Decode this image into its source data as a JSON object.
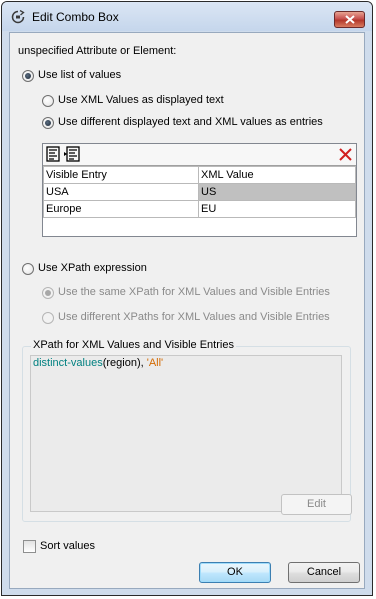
{
  "window": {
    "title": "Edit Combo Box"
  },
  "dialog": {
    "heading": "unspecified Attribute or Element:",
    "use_list_label": "Use list of values",
    "use_xml_values_label": "Use XML Values as displayed text",
    "use_different_label": "Use different displayed text and XML values as entries",
    "table": {
      "headers": [
        "Visible Entry",
        "XML Value"
      ],
      "rows": [
        [
          "USA",
          "US"
        ],
        [
          "Europe",
          "EU"
        ]
      ]
    },
    "use_xpath_label": "Use XPath expression",
    "same_xpath_label": "Use the same XPath for XML Values and Visible Entries",
    "different_xpaths_label": "Use different XPaths for XML Values and Visible Entries",
    "xpath_group_label": "XPath for XML Values and Visible Entries",
    "xpath_expression": {
      "function": "distinct-values",
      "args": "(region), ",
      "literal": "'All'"
    },
    "edit_label": "Edit",
    "sort_label": "Sort values",
    "ok_label": "OK",
    "cancel_label": "Cancel"
  }
}
